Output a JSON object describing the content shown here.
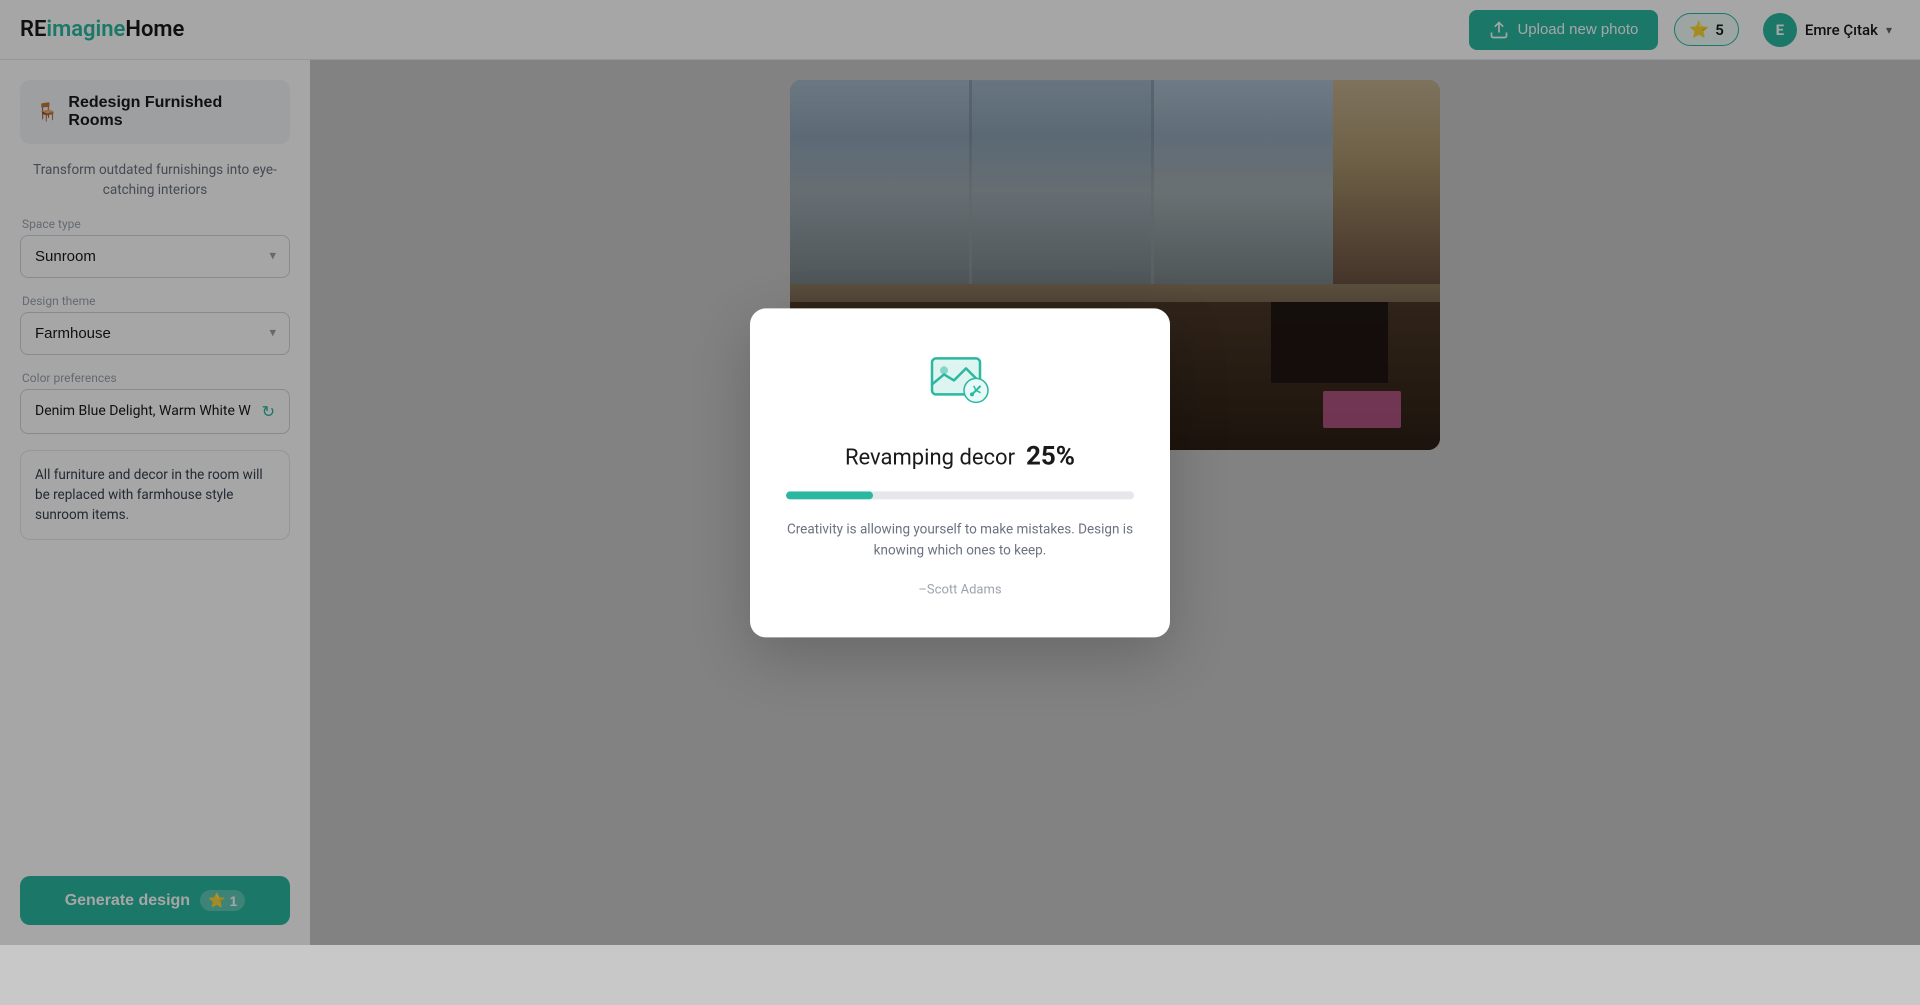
{
  "app": {
    "logo": {
      "re": "RE",
      "imagine": "imagine",
      "home": "Home"
    }
  },
  "header": {
    "upload_button": "Upload new photo",
    "credits": "5",
    "user_name": "Emre Çıtak",
    "user_initial": "E"
  },
  "sidebar": {
    "title": "Redesign Furnished Rooms",
    "subtitle": "Transform outdated furnishings into eye-catching interiors",
    "space_type_label": "Space type",
    "space_type_value": "Sunroom",
    "design_theme_label": "Design theme",
    "design_theme_value": "Farmhouse",
    "color_prefs_label": "Color preferences",
    "color_prefs_value": "Denim Blue Delight, Warm White W",
    "description": "All furniture and decor in the room will be replaced with farmhouse style sunroom items.",
    "generate_button": "Generate design",
    "generate_credit": "1"
  },
  "modal": {
    "title_prefix": "Revamping decor",
    "progress_percent": "25%",
    "progress_value": 25,
    "quote": "Creativity is allowing yourself to make mistakes. Design is knowing which ones to keep.",
    "author": "–Scott Adams"
  }
}
